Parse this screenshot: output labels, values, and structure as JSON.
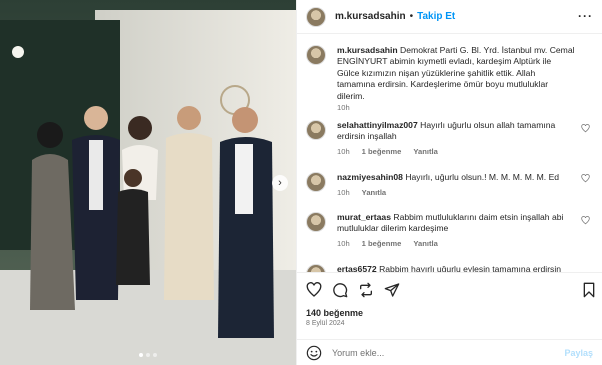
{
  "header": {
    "username": "m.kursadsahin",
    "separator": "•",
    "follow_label": "Takip Et",
    "more_label": "···"
  },
  "caption": {
    "username": "m.kursadsahin",
    "text": "Demokrat Parti G. Bl. Yrd. İstanbul mv. Cemal ENGİNYURT abimin kıymetli evladı, kardeşim Alptürk ile Gülce kızımızın nişan yüzüklerine şahitlik ettik. Allah tamamına erdirsin. Kardeşlerime ömür boyu mutluluklar dilerim.",
    "time": "10h"
  },
  "comments": [
    {
      "username": "selahattinyilmaz007",
      "text": "Hayırlı uğurlu olsun allah tamamına erdirsin inşallah",
      "time": "10h",
      "likes": "1 beğenme",
      "reply": "Yanıtla"
    },
    {
      "username": "nazmiyesahin08",
      "text": "Hayırlı, uğurlu olsun.! M. M. M. M. M. Ed",
      "time": "10h",
      "likes": "",
      "reply": "Yanıtla"
    },
    {
      "username": "murat_ertaas",
      "text": "Rabbim mutluluklarını daim etsin inşallah abi mutluluklar dilerim kardeşime",
      "time": "10h",
      "likes": "1 beğenme",
      "reply": "Yanıtla"
    },
    {
      "username": "ertas6572",
      "text": "Rabbim hayırlı uğurlu eylesin tamamına erdirsin",
      "time": "",
      "likes": "",
      "reply": ""
    }
  ],
  "actions": {
    "icons": [
      "heart-icon",
      "comment-icon",
      "repost-icon",
      "share-icon",
      "bookmark-icon"
    ],
    "likes_label": "140 beğenme",
    "date": "8 Eylül 2024"
  },
  "comment_input": {
    "placeholder": "Yorum ekle...",
    "post_label": "Paylaş"
  },
  "carousel": {
    "slides": 3,
    "active": 1,
    "next_label": "›"
  },
  "colors": {
    "accent": "#0095f6",
    "meta": "#737373",
    "border": "#efefef"
  }
}
